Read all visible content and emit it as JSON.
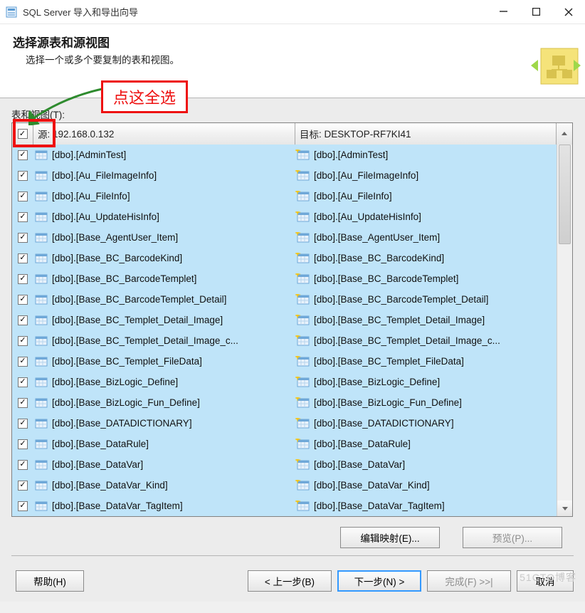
{
  "window": {
    "title": "SQL Server 导入和导出向导"
  },
  "header": {
    "title": "选择源表和源视图",
    "subtitle": "选择一个或多个要复制的表和视图。"
  },
  "tables_label": "表和视图(T):",
  "annotation": "点这全选",
  "columns": {
    "check": "",
    "source_prefix": "源",
    "source_value": ": 192.168.0.132",
    "target_prefix": "目标",
    "target_value": ": DESKTOP-RF7KI41"
  },
  "rows": [
    {
      "src": "[dbo].[AdminTest]",
      "tgt": "[dbo].[AdminTest]"
    },
    {
      "src": "[dbo].[Au_FileImageInfo]",
      "tgt": "[dbo].[Au_FileImageInfo]"
    },
    {
      "src": "[dbo].[Au_FileInfo]",
      "tgt": "[dbo].[Au_FileInfo]"
    },
    {
      "src": "[dbo].[Au_UpdateHisInfo]",
      "tgt": "[dbo].[Au_UpdateHisInfo]"
    },
    {
      "src": "[dbo].[Base_AgentUser_Item]",
      "tgt": "[dbo].[Base_AgentUser_Item]"
    },
    {
      "src": "[dbo].[Base_BC_BarcodeKind]",
      "tgt": "[dbo].[Base_BC_BarcodeKind]"
    },
    {
      "src": "[dbo].[Base_BC_BarcodeTemplet]",
      "tgt": "[dbo].[Base_BC_BarcodeTemplet]"
    },
    {
      "src": "[dbo].[Base_BC_BarcodeTemplet_Detail]",
      "tgt": "[dbo].[Base_BC_BarcodeTemplet_Detail]"
    },
    {
      "src": "[dbo].[Base_BC_Templet_Detail_Image]",
      "tgt": "[dbo].[Base_BC_Templet_Detail_Image]"
    },
    {
      "src": "[dbo].[Base_BC_Templet_Detail_Image_c...",
      "tgt": "[dbo].[Base_BC_Templet_Detail_Image_c..."
    },
    {
      "src": "[dbo].[Base_BC_Templet_FileData]",
      "tgt": "[dbo].[Base_BC_Templet_FileData]"
    },
    {
      "src": "[dbo].[Base_BizLogic_Define]",
      "tgt": "[dbo].[Base_BizLogic_Define]"
    },
    {
      "src": "[dbo].[Base_BizLogic_Fun_Define]",
      "tgt": "[dbo].[Base_BizLogic_Fun_Define]"
    },
    {
      "src": "[dbo].[Base_DATADICTIONARY]",
      "tgt": "[dbo].[Base_DATADICTIONARY]"
    },
    {
      "src": "[dbo].[Base_DataRule]",
      "tgt": "[dbo].[Base_DataRule]"
    },
    {
      "src": "[dbo].[Base_DataVar]",
      "tgt": "[dbo].[Base_DataVar]"
    },
    {
      "src": "[dbo].[Base_DataVar_Kind]",
      "tgt": "[dbo].[Base_DataVar_Kind]"
    },
    {
      "src": "[dbo].[Base_DataVar_TagItem]",
      "tgt": "[dbo].[Base_DataVar_TagItem]"
    }
  ],
  "buttons": {
    "edit_mapping": "编辑映射(E)...",
    "preview": "预览(P)...",
    "help": "帮助(H)",
    "back": "< 上一步(B)",
    "next": "下一步(N) >",
    "finish": "完成(F) >>|",
    "cancel": "取消"
  },
  "watermark": "51CTO博客"
}
